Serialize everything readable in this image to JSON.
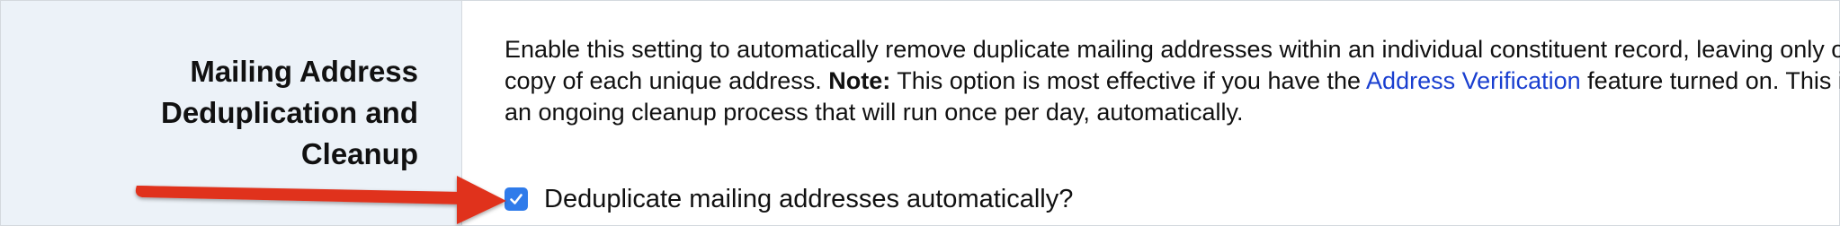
{
  "section": {
    "title": "Mailing Address\nDeduplication and\nCleanup"
  },
  "description": {
    "part1": "Enable this setting to automatically remove duplicate mailing addresses within an individual constituent record, leaving only one copy of each unique address. ",
    "note_label": "Note:",
    "part2": " This option is most effective if you have the ",
    "link_text": "Address Verification",
    "part3": " feature turned on. This is an ongoing cleanup process that will run once per day, automatically."
  },
  "checkbox": {
    "label": "Deduplicate mailing addresses automatically?",
    "checked": true,
    "color": "#2f7bea"
  },
  "annotation": {
    "arrow_color": "#e0321f"
  }
}
